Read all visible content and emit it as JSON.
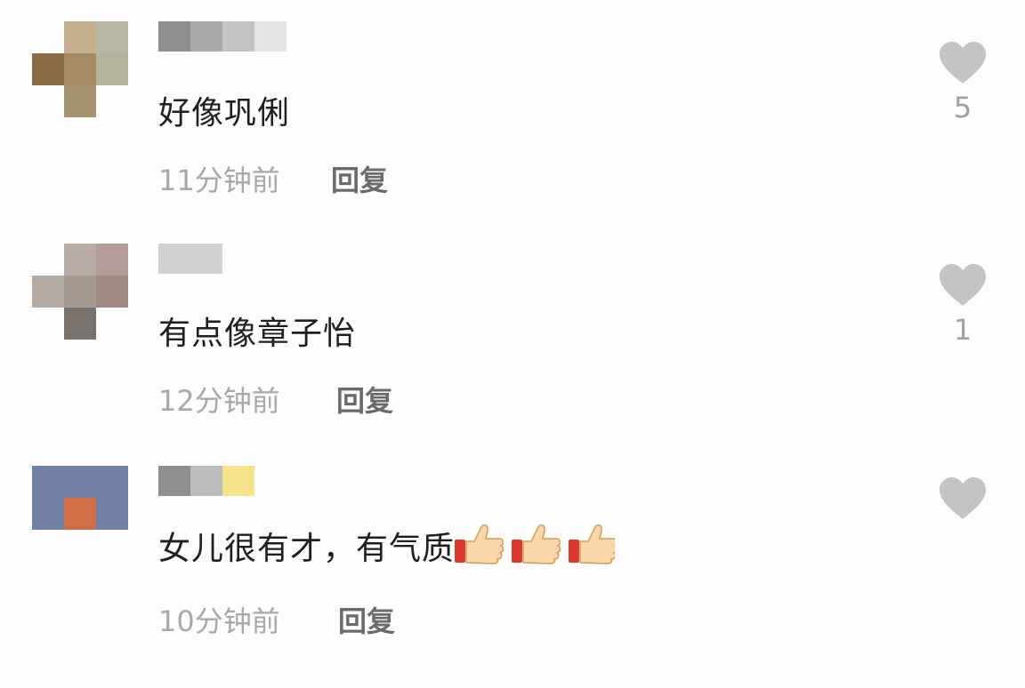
{
  "colors": {
    "background": "#fdfdfd",
    "comment_text": "#1f1f1f",
    "time_text": "#a8a8a8",
    "reply_text": "#6a6a6a",
    "heart": "#c4c4c4"
  },
  "comments": [
    {
      "text": "好像巩俐",
      "time": "11分钟前",
      "reply_label": "回复",
      "likes": "5",
      "avatar_colors": [
        "#c6b08f",
        "#b9b7a4",
        "#8a6b47",
        "#a38c64",
        "#b6a582",
        "#c9c8c1",
        "#fdfdfd",
        "#a89371",
        "#fdfdfd"
      ],
      "name_colors": [
        "#8e8e8e",
        "#a9a9a9",
        "#c4c4c4",
        "#e4e4e4"
      ]
    },
    {
      "text": "有点像章子怡",
      "time": "12分钟前",
      "reply_label": "回复",
      "likes": "1",
      "avatar_colors": [
        "#fdfdfd",
        "#b8aca5",
        "#b49c98",
        "#b5aba3",
        "#a6998f",
        "#a08883",
        "#fdfdfd",
        "#78716c",
        "#fdfdfd"
      ],
      "name_colors": [
        "#d1d1d1",
        "#d1d1d1"
      ]
    },
    {
      "text": "女儿很有才，有气质",
      "emoji_icon": "thumbs-up-icon",
      "emoji_count": 3,
      "time": "10分钟前",
      "reply_label": "回复",
      "likes": "",
      "avatar_colors": [
        "#6f7fa6",
        "#6f7fa6",
        "#6f7fa6",
        "#6f7fa6",
        "#cf6e47",
        "#6f7fa6"
      ],
      "name_colors": [
        "#8f8f8f",
        "#bdbdbd",
        "#f5e38c"
      ]
    }
  ]
}
